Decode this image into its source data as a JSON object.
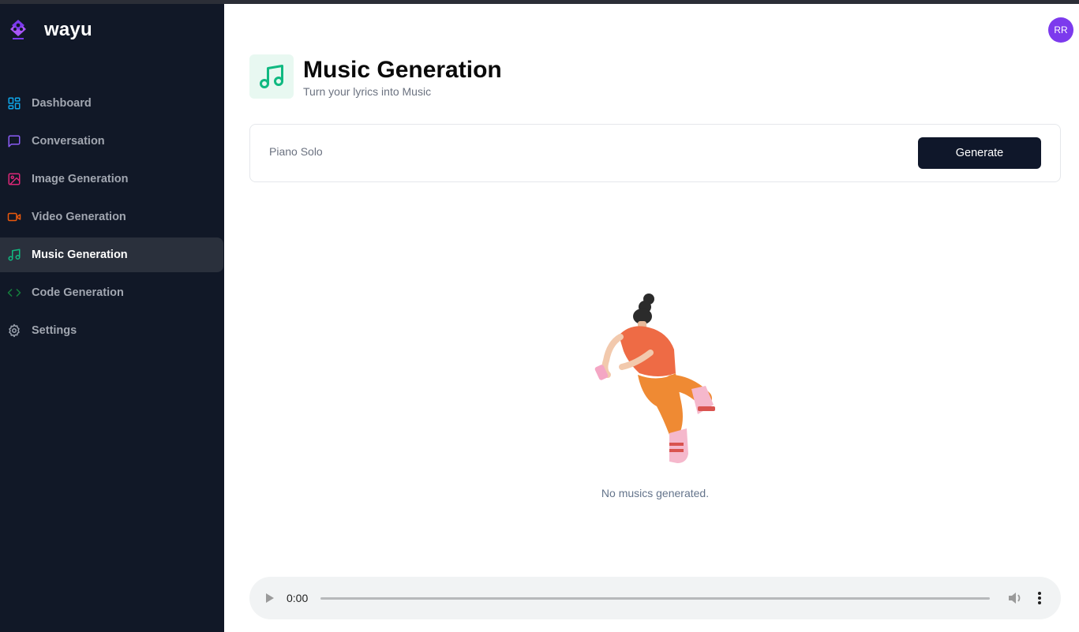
{
  "brand": {
    "name": "wayu",
    "logo_icon": "diamond-logo-icon"
  },
  "sidebar": {
    "items": [
      {
        "label": "Dashboard",
        "icon": "layout-dashboard-icon",
        "color": "#0ea5e9",
        "active": false
      },
      {
        "label": "Conversation",
        "icon": "message-square-icon",
        "color": "#8b5cf6",
        "active": false
      },
      {
        "label": "Image Generation",
        "icon": "image-icon",
        "color": "#db2777",
        "active": false
      },
      {
        "label": "Video Generation",
        "icon": "video-icon",
        "color": "#ea580c",
        "active": false
      },
      {
        "label": "Music Generation",
        "icon": "music-icon",
        "color": "#10b981",
        "active": true
      },
      {
        "label": "Code Generation",
        "icon": "code-icon",
        "color": "#15803d",
        "active": false
      },
      {
        "label": "Settings",
        "icon": "settings-icon",
        "color": "#9ca3af",
        "active": false
      }
    ]
  },
  "user": {
    "initials": "RR",
    "color": "#7c3aed"
  },
  "header": {
    "title": "Music Generation",
    "subtitle": "Turn your lyrics into Music",
    "icon": "music-icon",
    "icon_color": "#10b981",
    "icon_bg": "#e8f8f1"
  },
  "prompt": {
    "value": "Piano Solo",
    "button_label": "Generate"
  },
  "empty_state": {
    "text": "No musics generated."
  },
  "audio": {
    "time": "0:00"
  }
}
